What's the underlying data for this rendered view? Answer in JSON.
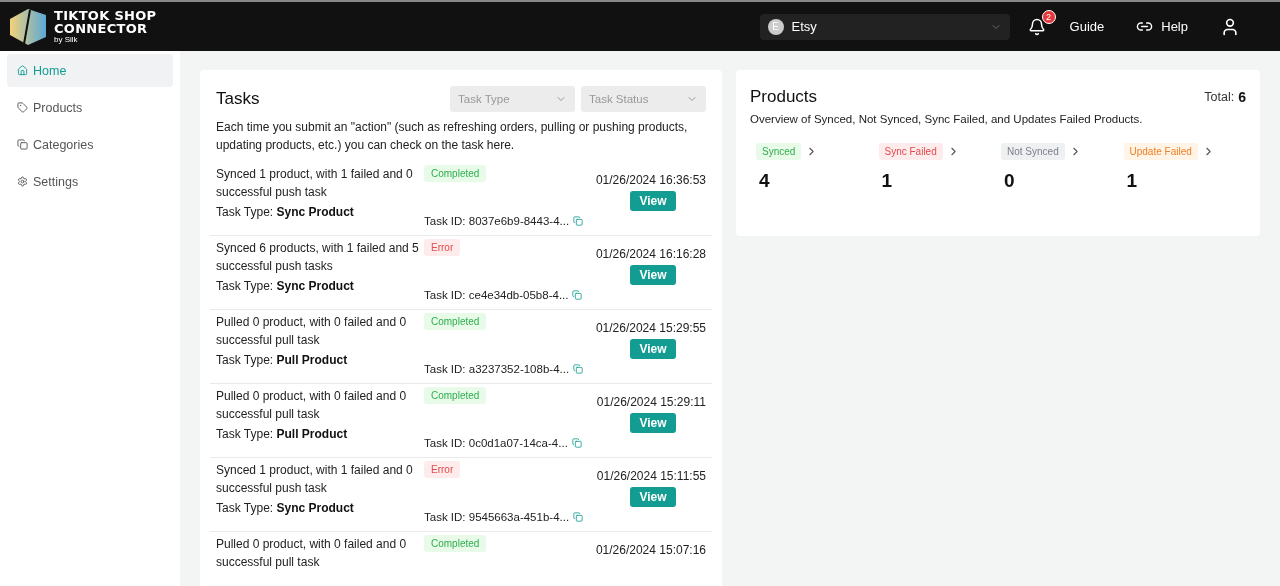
{
  "header": {
    "logo": {
      "line_1": "TIKTOK SHOP",
      "line_2": "CONNECTOR",
      "byline": "by Silk"
    },
    "store_select": {
      "avatar": "E",
      "value": "Etsy"
    },
    "notifications": {
      "count": "2"
    },
    "links": [
      "Guide",
      "Help"
    ]
  },
  "sidebar": {
    "items": [
      {
        "label": "Home",
        "kind": "home",
        "selected": true
      },
      {
        "label": "Products",
        "kind": "products",
        "selected": false
      },
      {
        "label": "Categories",
        "kind": "categories",
        "selected": false
      },
      {
        "label": "Settings",
        "kind": "settings",
        "selected": false
      }
    ]
  },
  "tasks": {
    "title": "Tasks",
    "filters": [
      {
        "placeholder": "Task Type"
      },
      {
        "placeholder": "Task Status"
      }
    ],
    "description": "Each time you submit an \"action\" (such as refreshing orders, pulling or pushing products, updating products, etc.) you can check on the task here.",
    "rows": [
      {
        "summary": "Synced 1 product, with 1 failed and 0 successful push task",
        "status": "Completed",
        "kind": "completed",
        "task_type": "Task Type: **Sync Product**",
        "task_id": "Task ID: 8037e6b9-8443-4...",
        "time": "01/26/2024 16:36:53",
        "action": "View"
      },
      {
        "summary": "Synced 6 products, with 1 failed and 5 successful push tasks",
        "status": "Error",
        "kind": "error",
        "task_type": "Task Type: **Sync Product**",
        "task_id": "Task ID: ce4e34db-05b8-4...",
        "time": "01/26/2024 16:16:28",
        "action": "View"
      },
      {
        "summary": "Pulled 0 product, with 0 failed and 0 successful pull task",
        "status": "Completed",
        "kind": "completed",
        "task_type": "Task Type: **Pull Product**",
        "task_id": "Task ID: a3237352-108b-4...",
        "time": "01/26/2024 15:29:55",
        "action": "View"
      },
      {
        "summary": "Pulled 0 product, with 0 failed and 0 successful pull task",
        "status": "Completed",
        "kind": "completed",
        "task_type": "Task Type: **Pull Product**",
        "task_id": "Task ID: 0c0d1a07-14ca-4...",
        "time": "01/26/2024 15:29:11",
        "action": "View"
      },
      {
        "summary": "Synced 1 product, with 1 failed and 0 successful push task",
        "status": "Error",
        "kind": "error",
        "task_type": "Task Type: **Sync Product**",
        "task_id": "Task ID: 9545663a-451b-4...",
        "time": "01/26/2024 15:11:55",
        "action": "View"
      },
      {
        "summary": "Pulled 0 product, with 0 failed and 0 successful pull task",
        "status": "Completed",
        "kind": "completed",
        "time": "01/26/2024 15:07:16"
      }
    ]
  },
  "products": {
    "title": "Products",
    "total_label": "Total:",
    "total": "6",
    "description": "Overview of Synced, Not Synced, Sync Failed, and Updates Failed Products.",
    "stats": [
      {
        "label": "Synced",
        "kind": "synced",
        "count": "4"
      },
      {
        "label": "Sync Failed",
        "kind": "failed",
        "count": "1"
      },
      {
        "label": "Not Synced",
        "kind": "not_synced",
        "count": "0"
      },
      {
        "label": "Update Failed",
        "kind": "update_failed",
        "count": "1"
      }
    ]
  }
}
